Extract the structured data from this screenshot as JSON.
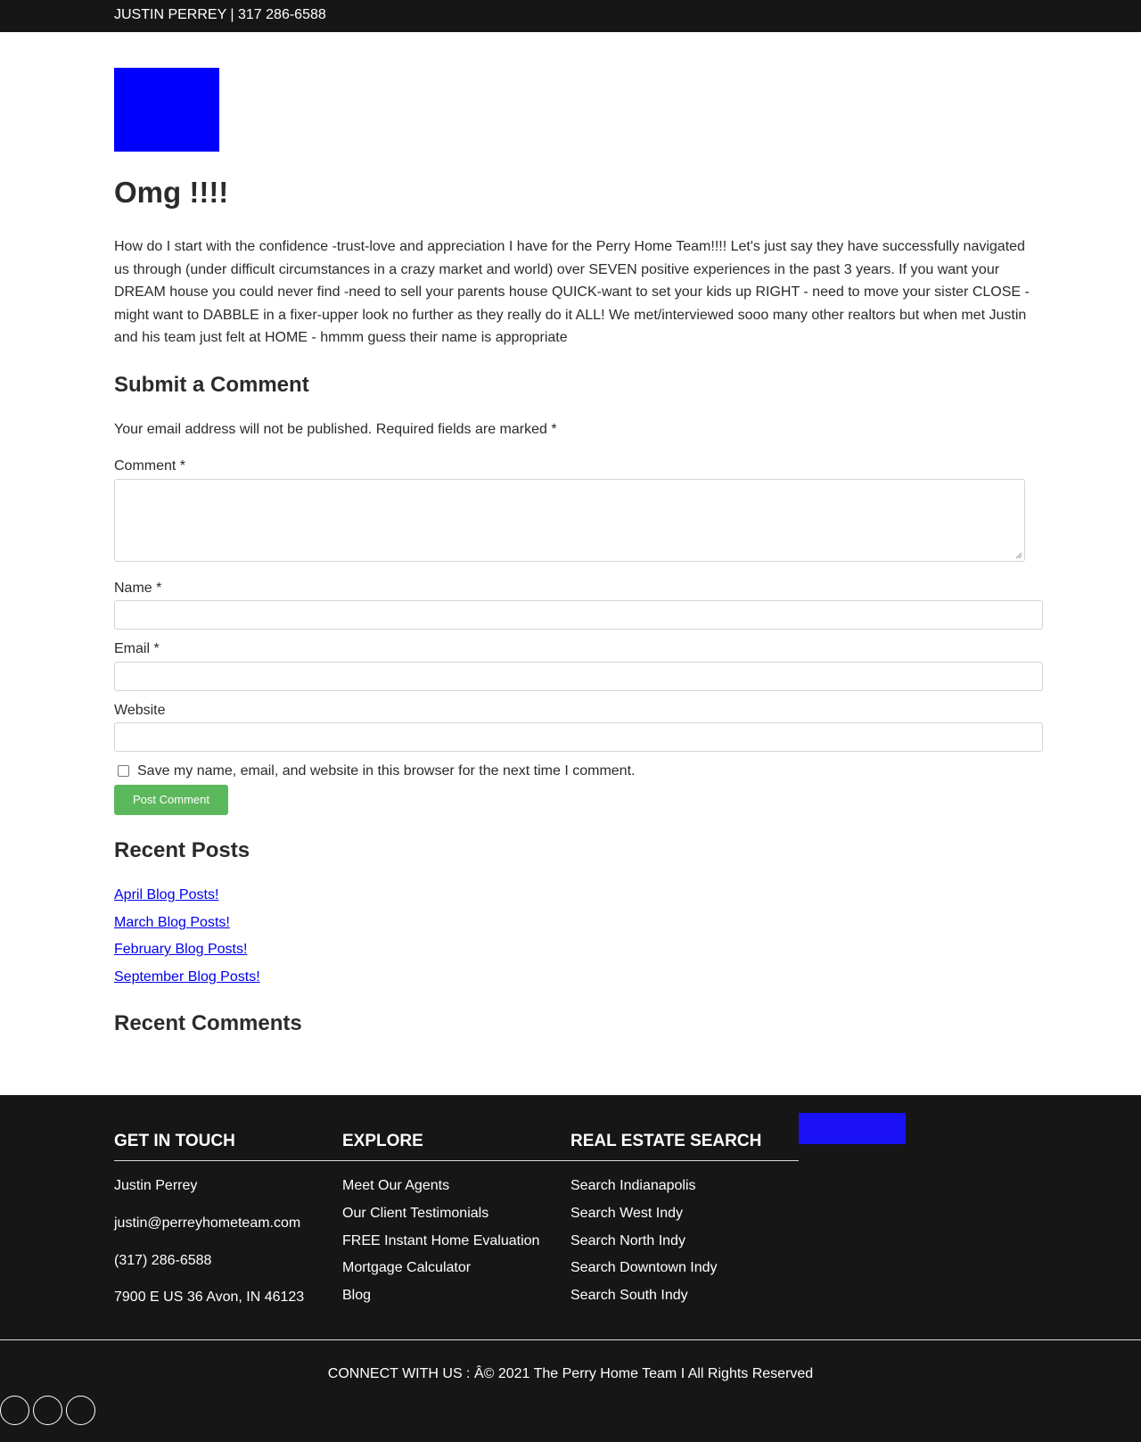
{
  "topbar": {
    "text": "JUSTIN PERREY | 317 286-6588"
  },
  "logo": {
    "color": "#0000ff"
  },
  "post": {
    "title": "Omg !!!!",
    "body": "How do I start with the confidence -trust-love and appreciation I have for the Perry Home Team!!!! Let's just say they have successfully navigated us through (under difficult circumstances in a crazy market and world) over SEVEN positive experiences in the past 3 years. If you want your DREAM house you could never find -need to sell your parents house QUICK-want to set your kids up RIGHT - need to move your sister CLOSE - might want to DABBLE in a fixer-upper look no further as they really do it ALL! We met/interviewed sooo many other realtors but when met Justin and his team just felt at HOME - hmmm guess their name is appropriate"
  },
  "comment_form": {
    "heading": "Submit a Comment",
    "note": "Your email address will not be published. Required fields are marked *",
    "comment_label": "Comment *",
    "name_label": "Name *",
    "email_label": "Email *",
    "website_label": "Website",
    "save_label": "Save my name, email, and website in this browser for the next time I comment.",
    "submit_label": "Post Comment",
    "submit_color": "#5cb85c"
  },
  "recent_posts": {
    "heading": "Recent Posts",
    "items": [
      "April Blog Posts!",
      "March Blog Posts!",
      "February Blog Posts!",
      "September Blog Posts!"
    ]
  },
  "recent_comments": {
    "heading": "Recent Comments"
  },
  "footer": {
    "get_in_touch": {
      "title": "GET IN TOUCH",
      "items": [
        "Justin Perrey",
        "justin@perreyhometeam.com",
        "(317) 286-6588",
        "7900 E US 36 Avon, IN 46123"
      ]
    },
    "explore": {
      "title": "EXPLORE",
      "items": [
        "Meet Our Agents",
        "Our Client Testimonials",
        "FREE Instant Home Evaluation",
        "Mortgage Calculator",
        "Blog"
      ]
    },
    "search": {
      "title": "REAL ESTATE SEARCH",
      "items": [
        "Search Indianapolis",
        "Search West Indy",
        "Search North Indy",
        "Search Downtown Indy",
        "Search South Indy"
      ]
    },
    "badge_color": "#1a12f4",
    "copyright": "CONNECT WITH US : Â© 2021 The Perry Home Team I All Rights Reserved"
  }
}
